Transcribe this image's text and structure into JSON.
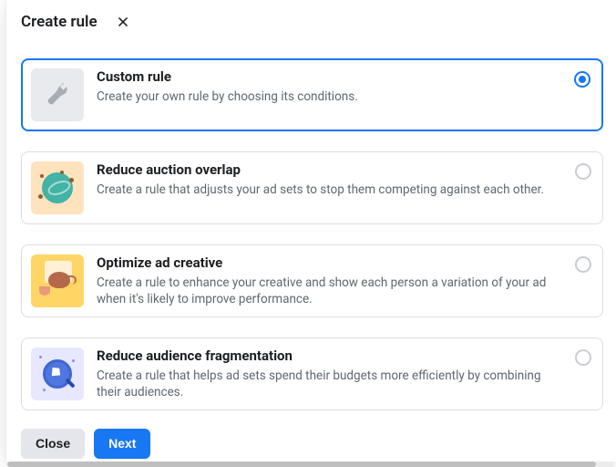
{
  "header": {
    "title": "Create rule"
  },
  "options": [
    {
      "id": "custom",
      "title": "Custom rule",
      "desc": "Create your own rule by choosing its conditions.",
      "selected": true,
      "icon": "wrench-icon",
      "thumb_bg": "#e8eaed"
    },
    {
      "id": "auction-overlap",
      "title": "Reduce auction overlap",
      "desc": "Create a rule that adjusts your ad sets to stop them competing against each other.",
      "selected": false,
      "icon": "globe-icon",
      "thumb_bg": "#ffe3bf"
    },
    {
      "id": "optimize-creative",
      "title": "Optimize ad creative",
      "desc": "Create a rule to enhance your creative and show each person a variation of your ad when it's likely to improve performance.",
      "selected": false,
      "icon": "kettle-icon",
      "thumb_bg": "#ffd666"
    },
    {
      "id": "audience-fragmentation",
      "title": "Reduce audience fragmentation",
      "desc": "Create a rule that helps ad sets spend their budgets more efficiently by combining their audiences.",
      "selected": false,
      "icon": "diamond-search-icon",
      "thumb_bg": "#e7e8ff"
    }
  ],
  "footer": {
    "close_label": "Close",
    "next_label": "Next"
  },
  "colors": {
    "primary": "#1877f2",
    "text": "#1c1e21",
    "muted": "#606770",
    "border": "#dadde1"
  }
}
